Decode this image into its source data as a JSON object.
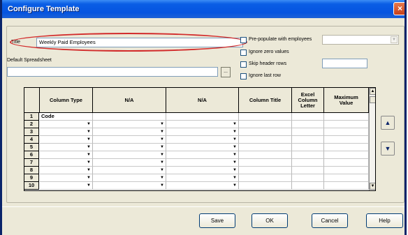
{
  "window": {
    "title": "Configure Template",
    "close_glyph": "×"
  },
  "form": {
    "title_label": "Title",
    "title_value": "Weekly Paid Employees",
    "spreadsheet_label": "Default Spreadsheet",
    "spreadsheet_value": "",
    "browse_label": "...",
    "prepopulate_label": "Pre-populate with employees",
    "prepopulate_checked": false,
    "ignore_zero_label": "Ignore zero values",
    "ignore_zero_checked": false,
    "skip_header_label": "Skip header rows",
    "skip_header_checked": false,
    "skip_header_value": "",
    "ignore_last_label": "Ignore last row",
    "ignore_last_checked": false,
    "employee_select_value": ""
  },
  "grid": {
    "headers": [
      "",
      "Column Type",
      "N/A",
      "N/A",
      "Column Title",
      "Excel Column Letter",
      "Maximum Value"
    ],
    "rows": [
      {
        "num": "1",
        "column_type": "Code",
        "dropdowns": false
      },
      {
        "num": "2",
        "column_type": "",
        "dropdowns": true
      },
      {
        "num": "3",
        "column_type": "",
        "dropdowns": true
      },
      {
        "num": "4",
        "column_type": "",
        "dropdowns": true
      },
      {
        "num": "5",
        "column_type": "",
        "dropdowns": true
      },
      {
        "num": "6",
        "column_type": "",
        "dropdowns": true
      },
      {
        "num": "7",
        "column_type": "",
        "dropdowns": true
      },
      {
        "num": "8",
        "column_type": "",
        "dropdowns": true
      },
      {
        "num": "9",
        "column_type": "",
        "dropdowns": true
      },
      {
        "num": "10",
        "column_type": "",
        "dropdowns": true
      }
    ],
    "dropdown_glyph": "▼",
    "scroll_up_glyph": "▲",
    "scroll_down_glyph": "▼"
  },
  "side_buttons": {
    "up_glyph": "▲",
    "down_glyph": "▼"
  },
  "buttons": {
    "save": "Save",
    "ok": "OK",
    "cancel": "Cancel",
    "help": "Help"
  },
  "colors": {
    "titlebar": "#0554e0",
    "highlight_ellipse": "#d22b2b",
    "window_bg": "#ece9d8"
  }
}
